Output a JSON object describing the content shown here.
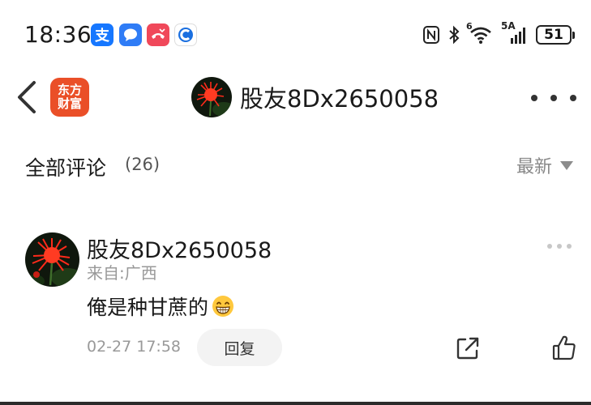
{
  "status_bar": {
    "time": "18:36",
    "alipay_char": "支",
    "battery_level": "51",
    "network_label": "5A",
    "wifi_badge": "6"
  },
  "nav": {
    "app_logo_line1": "东方",
    "app_logo_line2": "财富",
    "title": "股友8Dx2650058"
  },
  "comments": {
    "title": "全部评论",
    "count": "(26)",
    "sort_label": "最新",
    "items": [
      {
        "username": "股友8Dx2650058",
        "location": "来自:广西",
        "text": "俺是种甘蔗的",
        "emoji": "grinning-face-emoji",
        "time": "02-27 17:58",
        "reply_label": "回复"
      }
    ]
  },
  "colors": {
    "logo": "#ea4f28",
    "alipay": "#1677ff",
    "message_app": "#2f7cf6",
    "call_app": "#f0485a",
    "muted_text": "#999999"
  }
}
